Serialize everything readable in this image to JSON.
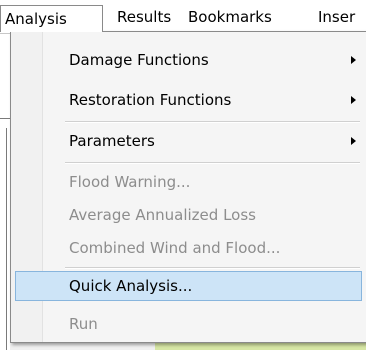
{
  "menubar": {
    "items": [
      {
        "label": "Analysis"
      },
      {
        "label": "Results"
      },
      {
        "label": "Bookmarks"
      },
      {
        "label": "Inser"
      }
    ]
  },
  "analysis_menu": {
    "items": [
      {
        "label": "Damage Functions",
        "enabled": true,
        "submenu": true
      },
      {
        "label": "Restoration Functions",
        "enabled": true,
        "submenu": true
      },
      {
        "label": "Parameters",
        "enabled": true,
        "submenu": true
      },
      {
        "label": "Flood Warning...",
        "enabled": false
      },
      {
        "label": "Average Annualized Loss",
        "enabled": false
      },
      {
        "label": "Combined Wind and Flood...",
        "enabled": false
      },
      {
        "label": "Quick Analysis...",
        "enabled": true,
        "highlighted": true
      },
      {
        "label": "Run",
        "enabled": false
      }
    ]
  },
  "colors": {
    "highlight_fill": "#cde4f7",
    "highlight_border": "#88b5dd",
    "disabled_text": "#8d8d8d"
  }
}
